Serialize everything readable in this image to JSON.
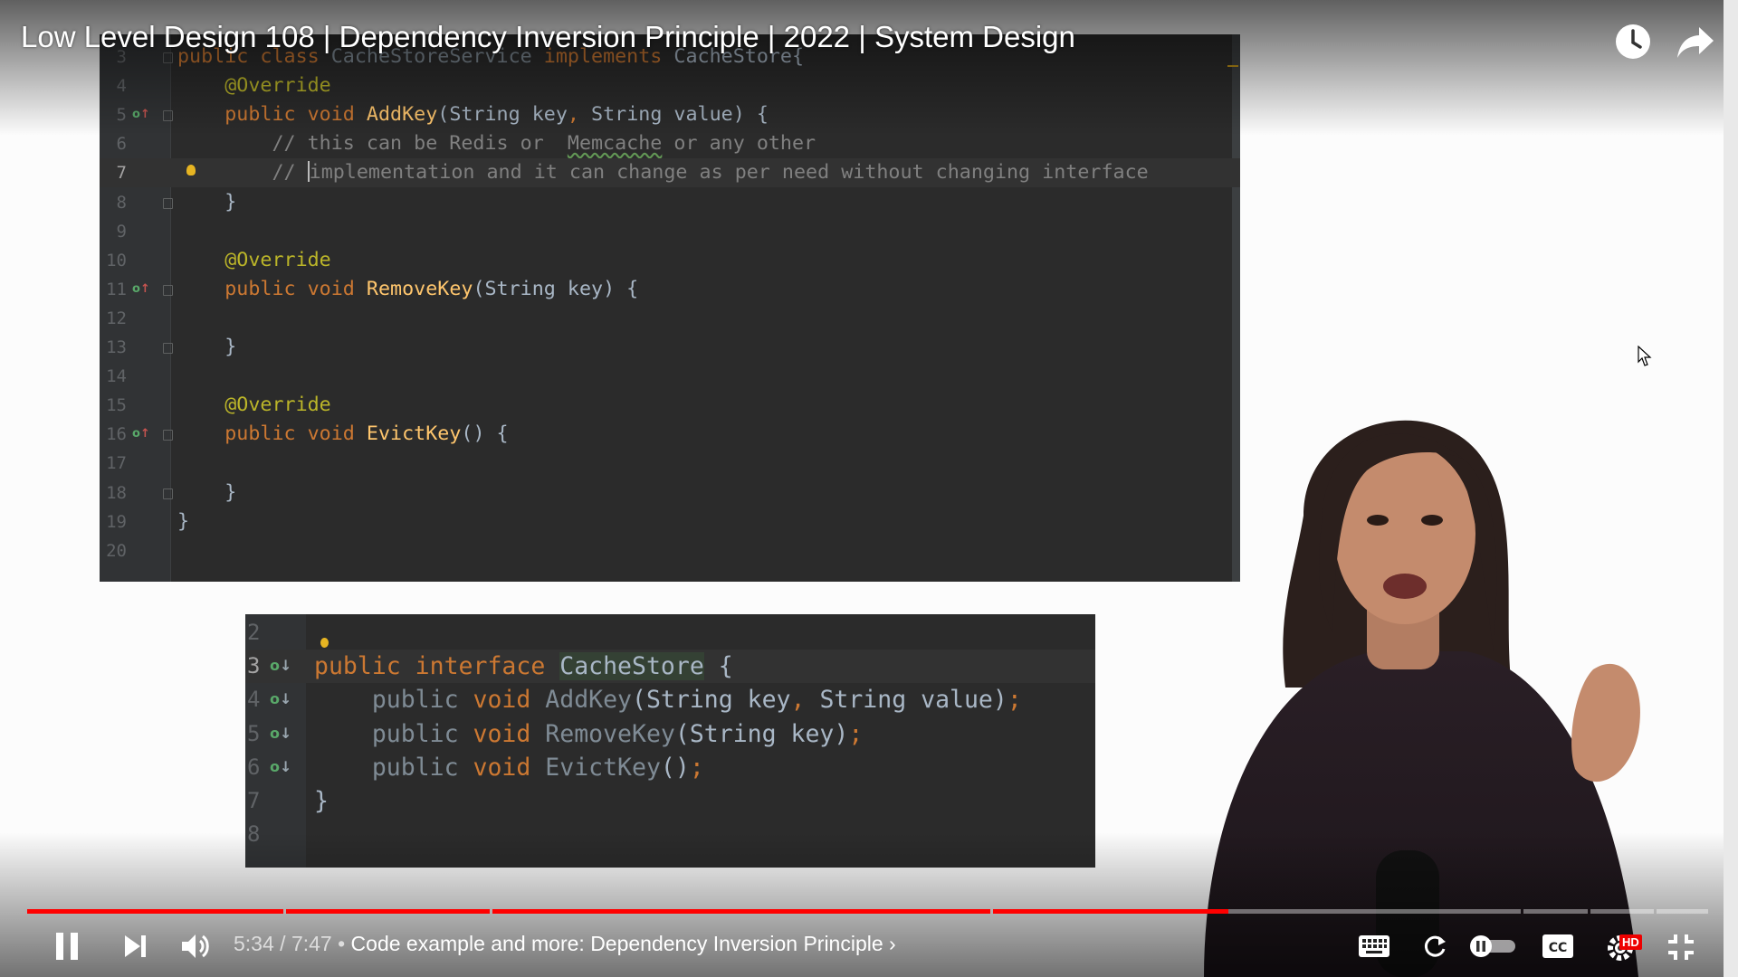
{
  "video": {
    "title": "Low Level Design 108 | Dependency Inversion Principle | 2022 | System Design"
  },
  "editor_top": {
    "current_line": 7,
    "lines": [
      {
        "n": "3",
        "tokens": [
          [
            "kw",
            "public class "
          ],
          [
            "dim",
            "CacheStoreService "
          ],
          [
            "kw",
            "implements "
          ],
          [
            "type",
            "CacheStore{"
          ]
        ]
      },
      {
        "n": "4",
        "tokens": [
          [
            "ann",
            "    @Override"
          ]
        ]
      },
      {
        "n": "5",
        "icon": "override",
        "tokens": [
          [
            "kw",
            "    public void "
          ],
          [
            "fn",
            "AddKey"
          ],
          [
            "type",
            "(String key"
          ],
          [
            "kw",
            ", "
          ],
          [
            "type",
            "String value) {"
          ]
        ]
      },
      {
        "n": "6",
        "tokens": [
          [
            "cmt",
            "        // this can be Redis or  "
          ],
          [
            "cmt squiggle",
            "Memcache"
          ],
          [
            "cmt",
            " or any other"
          ]
        ]
      },
      {
        "n": "7",
        "bulb": true,
        "tokens": [
          [
            "cmt",
            "        // "
          ],
          [
            "caret",
            ""
          ],
          [
            "cmt",
            "implementation and it can change as per need without changing interface"
          ]
        ]
      },
      {
        "n": "8",
        "tokens": [
          [
            "type",
            "    }"
          ]
        ]
      },
      {
        "n": "9",
        "tokens": []
      },
      {
        "n": "10",
        "tokens": [
          [
            "ann",
            "    @Override"
          ]
        ]
      },
      {
        "n": "11",
        "icon": "override",
        "tokens": [
          [
            "kw",
            "    public void "
          ],
          [
            "fn",
            "RemoveKey"
          ],
          [
            "type",
            "(String key) {"
          ]
        ]
      },
      {
        "n": "12",
        "tokens": []
      },
      {
        "n": "13",
        "tokens": [
          [
            "type",
            "    }"
          ]
        ]
      },
      {
        "n": "14",
        "tokens": []
      },
      {
        "n": "15",
        "tokens": [
          [
            "ann",
            "    @Override"
          ]
        ]
      },
      {
        "n": "16",
        "icon": "override",
        "tokens": [
          [
            "kw",
            "    public void "
          ],
          [
            "fn",
            "EvictKey"
          ],
          [
            "type",
            "() {"
          ]
        ]
      },
      {
        "n": "17",
        "tokens": []
      },
      {
        "n": "18",
        "tokens": [
          [
            "type",
            "    }"
          ]
        ]
      },
      {
        "n": "19",
        "tokens": [
          [
            "type",
            "}"
          ]
        ]
      },
      {
        "n": "20",
        "tokens": []
      }
    ]
  },
  "editor_bottom": {
    "current_line": 3,
    "lines": [
      {
        "n": "2",
        "tokens": []
      },
      {
        "n": "3",
        "icon": "implemented",
        "tokens": [
          [
            "kw",
            "public interface "
          ],
          [
            "type hl-ident",
            "CacheStore"
          ],
          [
            "type",
            " {"
          ]
        ]
      },
      {
        "n": "4",
        "icon": "implemented",
        "tokens": [
          [
            "dim",
            "    public "
          ],
          [
            "kw",
            "void "
          ],
          [
            "dim",
            "AddKey"
          ],
          [
            "type",
            "(String key"
          ],
          [
            "kw",
            ", "
          ],
          [
            "type",
            "String value)"
          ],
          [
            "kw",
            ";"
          ]
        ]
      },
      {
        "n": "5",
        "icon": "implemented",
        "tokens": [
          [
            "dim",
            "    public "
          ],
          [
            "kw",
            "void "
          ],
          [
            "dim",
            "RemoveKey"
          ],
          [
            "type",
            "(String key)"
          ],
          [
            "kw",
            ";"
          ]
        ]
      },
      {
        "n": "6",
        "icon": "implemented",
        "tokens": [
          [
            "dim",
            "    public "
          ],
          [
            "kw",
            "void "
          ],
          [
            "dim",
            "EvictKey"
          ],
          [
            "type",
            "()"
          ],
          [
            "kw",
            ";"
          ]
        ]
      },
      {
        "n": "7",
        "tokens": [
          [
            "type",
            "}"
          ]
        ]
      },
      {
        "n": "8",
        "tokens": []
      }
    ]
  },
  "player": {
    "current_time": "5:34",
    "duration": "7:47",
    "separator": " / ",
    "bullet": " • ",
    "chapter": "Code example and more: Dependency Inversion Principle",
    "chapter_chevron": "›",
    "played_fraction": 0.714,
    "chapter_segments": [
      0.0,
      0.1535,
      0.2765,
      0.5735,
      0.8885,
      0.9285,
      0.968
    ],
    "accent_color": "#ff0000",
    "hd_badge": "HD",
    "autoplay": "on"
  },
  "icons": {
    "watch_later": "clock-icon",
    "share": "share-arrow-icon",
    "pause": "pause-icon",
    "next": "skip-next-icon",
    "volume": "volume-icon",
    "keyboard": "keyboard-icon",
    "loop": "loop-icon",
    "autoplay": "autoplay-toggle-icon",
    "captions": "captions-icon",
    "settings": "gear-icon",
    "exit_fullscreen": "exit-fullscreen-icon",
    "cursor": "mouse-cursor-icon"
  }
}
